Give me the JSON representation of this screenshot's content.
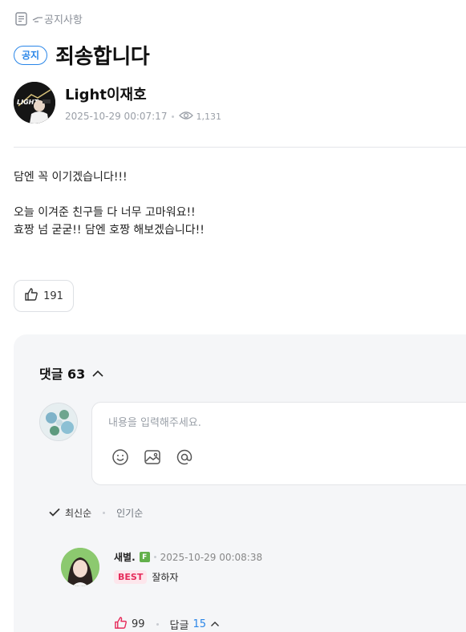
{
  "breadcrumb": {
    "label": "공지사항"
  },
  "post": {
    "badge": "공지",
    "title": "죄송합니다",
    "author": "Light이재호",
    "datetime": "2025-10-29 00:07:17",
    "views": "1,131",
    "body": [
      "담엔 꼭 이기겠습니다!!!",
      "오늘 이겨준 친구들 다 너무 고마워요!!",
      "효짱 넘 굳굳!! 담엔 호짱 해보겠습니다!!"
    ],
    "likes": "191"
  },
  "comments": {
    "header_label": "댓글",
    "count": "63",
    "input_placeholder": "내용을 입력해주세요.",
    "sort": {
      "latest": "최신순",
      "popular": "인기순"
    },
    "items": [
      {
        "name": "새별.",
        "level": "F",
        "datetime": "2025-10-29 00:08:38",
        "badge": "BEST",
        "text": "잘하자",
        "likes": "99",
        "reply_label": "답글",
        "reply_count": "15"
      }
    ]
  },
  "icons": [
    "document-icon",
    "hand-pointing-icon",
    "eye-icon",
    "thumbs-up-icon",
    "chevron-up-icon",
    "emoji-icon",
    "image-icon",
    "mention-icon",
    "check-icon"
  ],
  "colors": {
    "accent": "#2a86e8",
    "best": "#e62c5b",
    "level": "#63b04b",
    "panel": "#f5f6f8"
  }
}
